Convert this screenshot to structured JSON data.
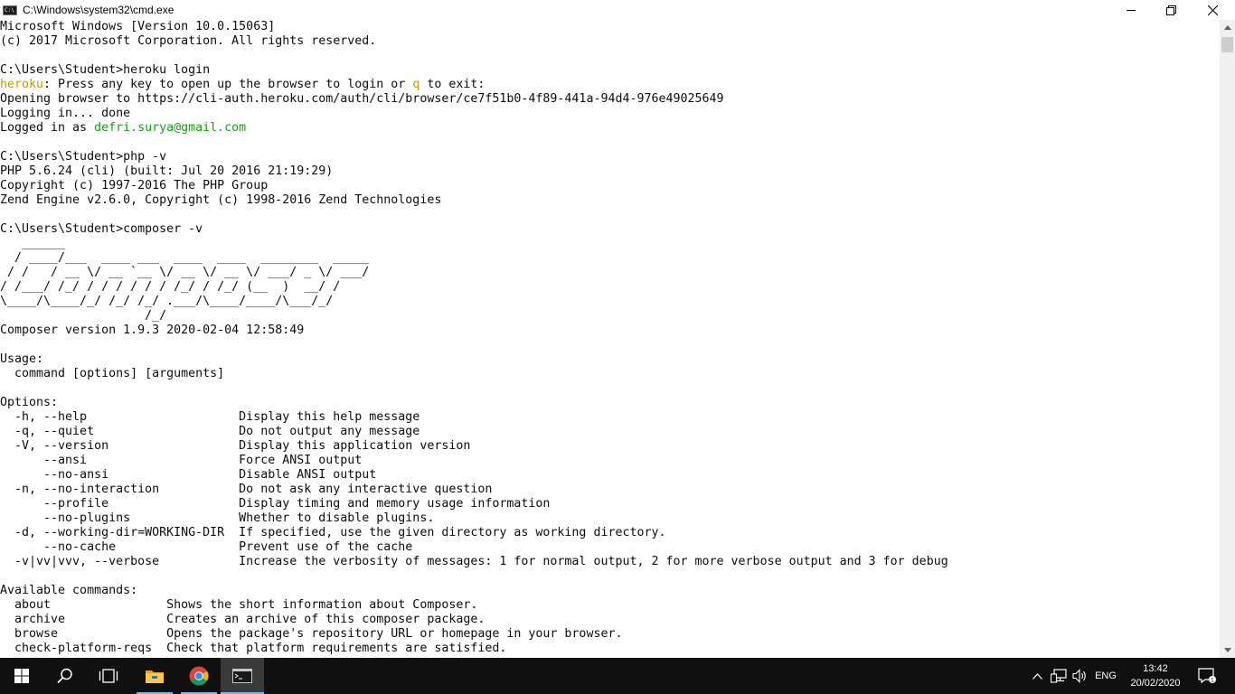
{
  "window": {
    "title": "C:\\Windows\\system32\\cmd.exe",
    "icon_text": "C:\\"
  },
  "console": {
    "lines": {
      "l01": "Microsoft Windows [Version 10.0.15063]",
      "l02": "(c) 2017 Microsoft Corporation. All rights reserved.",
      "l03": "",
      "l04": "C:\\Users\\Student>heroku login",
      "l05a": "heroku",
      "l05b": ": Press any key to open up the browser to login or ",
      "l05c": "q",
      "l05d": " to exit:",
      "l06": "Opening browser to https://cli-auth.heroku.com/auth/cli/browser/ce7f51b0-4f89-441a-94d4-976e49025649",
      "l07": "Logging in... done",
      "l08a": "Logged in as ",
      "l08b": "defri.surya@gmail.com",
      "l09": "",
      "l10": "C:\\Users\\Student>php -v",
      "l11": "PHP 5.6.24 (cli) (built: Jul 20 2016 21:19:29)",
      "l12": "Copyright (c) 1997-2016 The PHP Group",
      "l13": "Zend Engine v2.6.0, Copyright (c) 1998-2016 Zend Technologies",
      "l14": "",
      "l15": "C:\\Users\\Student>composer -v",
      "l16": "   ______",
      "l17": "  / ____/___  ____ ___  ____  ____  ________  _____",
      "l18": " / /   / __ \\/ __ `__ \\/ __ \\/ __ \\/ ___/ _ \\/ ___/",
      "l19": "/ /___/ /_/ / / / / / / /_/ / /_/ (__  )  __/ /",
      "l20": "\\____/\\____/_/ /_/ /_/ .___/\\____/____/\\___/_/",
      "l21": "                    /_/",
      "l22": "Composer version 1.9.3 2020-02-04 12:58:49",
      "l23": "",
      "l24": "Usage:",
      "l25": "  command [options] [arguments]",
      "l26": "",
      "l27": "Options:",
      "l28": "  -h, --help                     Display this help message",
      "l29": "  -q, --quiet                    Do not output any message",
      "l30": "  -V, --version                  Display this application version",
      "l31": "      --ansi                     Force ANSI output",
      "l32": "      --no-ansi                  Disable ANSI output",
      "l33": "  -n, --no-interaction           Do not ask any interactive question",
      "l34": "      --profile                  Display timing and memory usage information",
      "l35": "      --no-plugins               Whether to disable plugins.",
      "l36": "  -d, --working-dir=WORKING-DIR  If specified, use the given directory as working directory.",
      "l37": "      --no-cache                 Prevent use of the cache",
      "l38": "  -v|vv|vvv, --verbose           Increase the verbosity of messages: 1 for normal output, 2 for more verbose output and 3 for debug",
      "l39": "",
      "l40": "Available commands:",
      "l41": "  about                Shows the short information about Composer.",
      "l42": "  archive              Creates an archive of this composer package.",
      "l43": "  browse               Opens the package's repository URL or homepage in your browser.",
      "l44": "  check-platform-reqs  Check that platform requirements are satisfied."
    }
  },
  "taskbar": {
    "apps": [
      "start-icon",
      "search-icon",
      "task-view-icon",
      "file-explorer-icon",
      "chrome-icon",
      "cmd-icon"
    ],
    "language": "ENG",
    "time": "13:42",
    "date": "20/02/2020"
  },
  "colors": {
    "console_text": "#0c0c0c",
    "console_green": "#13a10e",
    "console_yellow": "#c19c00",
    "taskbar_bg": "#101010",
    "accent": "#76b9ed"
  }
}
